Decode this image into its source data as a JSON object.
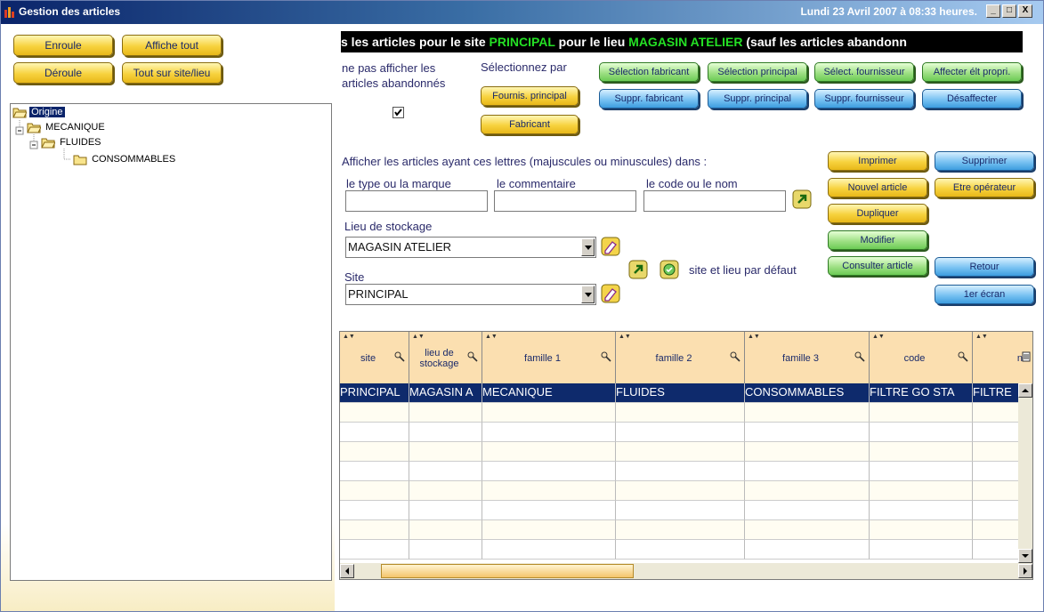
{
  "window": {
    "title": "Gestion des articles",
    "datetime": "Lundi 23 Avril 2007 à 08:33 heures.",
    "controls": [
      "_",
      "□",
      "X"
    ]
  },
  "left": {
    "buttons": {
      "enroule": "Enroule",
      "affiche_tout": "Affiche tout",
      "deroule": "Déroule",
      "tout_sur_site": "Tout sur site/lieu"
    },
    "tree": [
      {
        "label": "Origine",
        "selected": true
      },
      {
        "label": "MECANIQUE"
      },
      {
        "label": "FLUIDES"
      },
      {
        "label": "CONSOMMABLES"
      }
    ]
  },
  "banner": {
    "part1": "s les articles pour le site ",
    "site": "PRINCIPAL",
    "part2": " pour le lieu ",
    "lieu": "MAGASIN ATELIER",
    "part3": " (sauf les articles abandonn"
  },
  "filters": {
    "abandon_label": "ne pas afficher les articles abandonnés",
    "abandon_checked": "☑",
    "select_by_label": "Sélectionnez par",
    "fournis_principal": "Fournis. principal",
    "fabricant": "Fabricant",
    "sel_fabricant": "Sélection fabricant",
    "sel_principal": "Sélection principal",
    "sel_fournisseur": "Sélect. fournisseur",
    "affecter": "Affecter élt propri.",
    "suppr_fabricant": "Suppr. fabricant",
    "suppr_principal": "Suppr. principal",
    "suppr_fournisseur": "Suppr. fournisseur",
    "desaffecter": "Désaffecter",
    "search_hint": "Afficher les articles ayant ces lettres (majuscules ou minuscules) dans :",
    "type_marque": "le type ou la marque",
    "commentaire": "le commentaire",
    "code_nom": "le code ou le nom",
    "lieu_label": "Lieu de stockage",
    "lieu_value": "MAGASIN ATELIER",
    "site_label": "Site",
    "site_value": "PRINCIPAL",
    "defaults_label": "site et lieu par défaut"
  },
  "actions": {
    "imprimer": "Imprimer",
    "supprimer": "Supprimer",
    "nouvel_article": "Nouvel article",
    "etre_operateur": "Etre opérateur",
    "dupliquer": "Dupliquer",
    "modifier": "Modifier",
    "consulter": "Consulter article",
    "retour": "Retour",
    "premier_ecran": "1er écran"
  },
  "table": {
    "columns": [
      "site",
      "lieu de stockage",
      "famille 1",
      "famille 2",
      "famille 3",
      "code",
      "n"
    ],
    "rows": [
      [
        "PRINCIPAL",
        "MAGASIN A",
        "MECANIQUE",
        "FLUIDES",
        "CONSOMMABLES",
        "FILTRE GO STA",
        "FILTRE"
      ]
    ]
  },
  "colors": {
    "yellow_button": "#f7d23e",
    "green_button": "#9fe085",
    "blue_button": "#79c2f2",
    "header_bg": "#fbdfb0",
    "selected_row": "#0e2a6c",
    "banner_green": "#24e024"
  }
}
